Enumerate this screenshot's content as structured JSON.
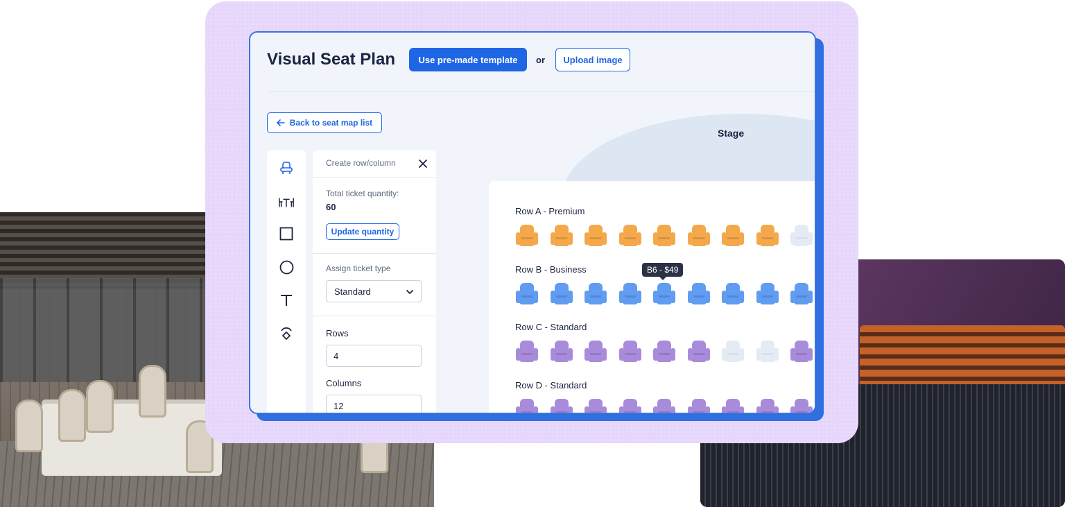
{
  "header": {
    "title": "Visual Seat Plan",
    "template_button": "Use pre-made template",
    "or_text": "or",
    "upload_button": "Upload image"
  },
  "back_button": {
    "label": "Back to seat map list"
  },
  "stage": {
    "label": "Stage"
  },
  "tools": [
    {
      "icon": "seat-icon"
    },
    {
      "icon": "table-icon"
    },
    {
      "icon": "square-icon"
    },
    {
      "icon": "circle-icon"
    },
    {
      "icon": "text-icon"
    },
    {
      "icon": "shape-icon"
    }
  ],
  "panel": {
    "header": "Create row/column",
    "total_label": "Total ticket quantity:",
    "total_value": "60",
    "update_button": "Update quantity",
    "assign_label": "Assign ticket type",
    "ticket_type": "Standard",
    "rows_label": "Rows",
    "rows_value": "4",
    "columns_label": "Columns",
    "columns_value": "12"
  },
  "seat_rows": [
    {
      "label": "Row A - Premium",
      "color": "#f5a84a",
      "seats": [
        "o",
        "o",
        "o",
        "o",
        "o",
        "o",
        "o",
        "o",
        "e"
      ]
    },
    {
      "label": "Row B - Business",
      "color": "#5f9cf2",
      "seats": [
        "o",
        "o",
        "o",
        "o",
        "o",
        "o",
        "o",
        "o",
        "o"
      ]
    },
    {
      "label": "Row C - Standard",
      "color": "#a98bdc",
      "seats": [
        "o",
        "o",
        "o",
        "o",
        "o",
        "o",
        "e",
        "e",
        "o"
      ]
    },
    {
      "label": "Row D - Standard",
      "color": "#a98bdc",
      "seats": [
        "o",
        "o",
        "o",
        "o",
        "o",
        "o",
        "o",
        "o",
        "o"
      ]
    }
  ],
  "empty_seat_color": "#e4ebf4",
  "tooltip": "B6 - $49"
}
